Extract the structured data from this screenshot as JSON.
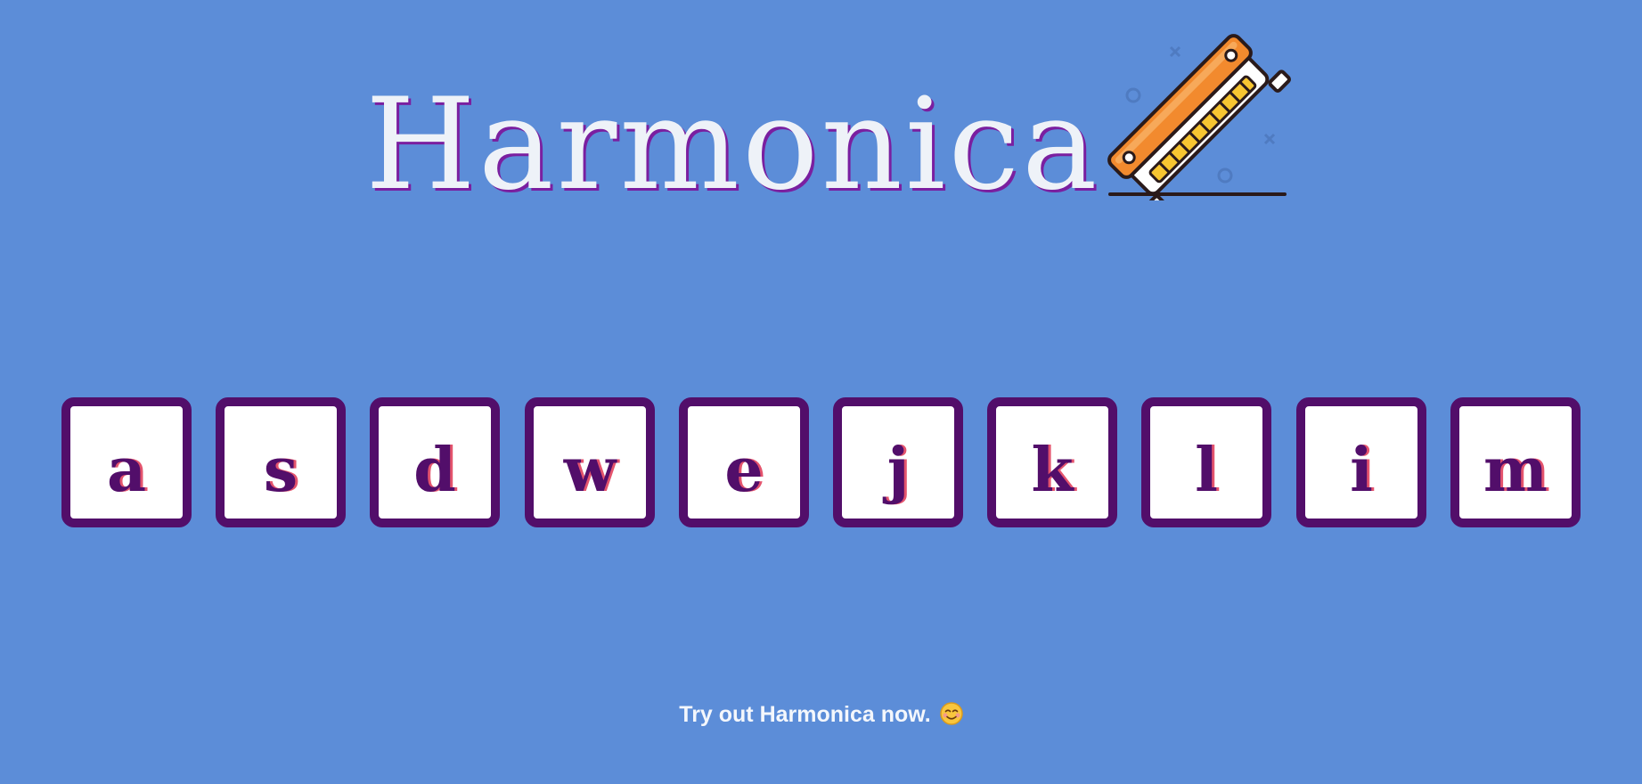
{
  "header": {
    "title": "Harmonica",
    "logo_icon": "harmonica-icon"
  },
  "keys": [
    {
      "letter": "a"
    },
    {
      "letter": "s"
    },
    {
      "letter": "d"
    },
    {
      "letter": "w"
    },
    {
      "letter": "e"
    },
    {
      "letter": "j"
    },
    {
      "letter": "k"
    },
    {
      "letter": "l"
    },
    {
      "letter": "i"
    },
    {
      "letter": "m"
    }
  ],
  "footer": {
    "text": "Try out Harmonica now.",
    "emoji_icon": "smiling-face-icon"
  },
  "colors": {
    "background": "#5c8dd8",
    "title_text": "#eef2f8",
    "title_shadow": "#7a1fa0",
    "key_border": "#520e6a",
    "key_face": "#ffffff",
    "key_letter": "#520e6a",
    "key_letter_shadow": "#e4546d",
    "harmonica_body": "#f28a2e",
    "harmonica_holes": "#f7c531"
  }
}
